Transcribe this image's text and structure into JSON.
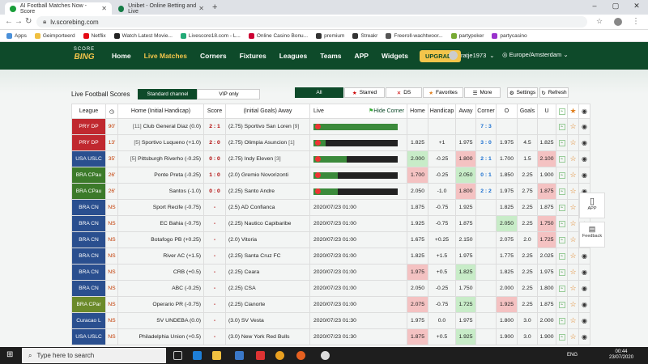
{
  "browser": {
    "tabs": [
      {
        "title": "AI Football Matches Now - Score",
        "favicon_color": "#1a9e3a"
      },
      {
        "title": "Unibet - Online Betting and Live",
        "favicon_color": "#147b45"
      }
    ],
    "url": "lv.scorebing.com",
    "bookmarks": [
      "Apps",
      "Geimporteerd",
      "Netflix",
      "Watch Latest Movie...",
      "Livescore18.com - L...",
      "Online Casino Bonu...",
      "premium",
      "Streakr",
      "Freeroll-wachtwoor...",
      "partypoker",
      "partycasino"
    ]
  },
  "site": {
    "logo_top": "SCORE",
    "logo_bottom": "BING",
    "nav": [
      "Home",
      "Live Matches",
      "Corners",
      "Fixtures",
      "Leagues",
      "Teams",
      "APP",
      "Widgets"
    ],
    "upgrade": "UPGRADE",
    "user": "ratje1973",
    "timezone": "Europe/Amsterdam",
    "brand_color": "#0e4a2a",
    "accent_color": "#f3c54b"
  },
  "panel": {
    "title": "Live Football Scores",
    "channels": [
      "Standard channel",
      "VIP only"
    ],
    "filters": [
      "All",
      "Starred",
      "DS",
      "Favorites",
      "More"
    ],
    "settings": "Settings",
    "refresh": "Refresh",
    "hide_corner": "Hide Corner"
  },
  "table": {
    "headers": {
      "league": "League",
      "home": "Home (Initial Handicap)",
      "score": "Score",
      "away": "(Initial Goals) Away",
      "live": "Live",
      "home_odds": "Home",
      "handicap": "Handicap",
      "away_odds": "Away",
      "corner": "Corner",
      "o": "O",
      "goals": "Goals",
      "u": "U"
    },
    "rows": [
      {
        "league": "PRY DP",
        "lc": "#c0282f",
        "min": "90'",
        "home": "Club General Diaz (0.0)",
        "hpre": "[11]",
        "score": "2 : 1",
        "away": "(2.75) Sportivo San Loren",
        "apost": "[9]",
        "live": "bar",
        "p": 100,
        "ho": "",
        "hc": "",
        "ao": "",
        "corner": "7 : 3",
        "o": "",
        "g": "",
        "u": "",
        "hcls": "",
        "acls": "",
        "ocls": "",
        "ucls": ""
      },
      {
        "league": "PRY DP",
        "lc": "#c0282f",
        "min": "13'",
        "home": "Sportivo Luqueno (+1.0)",
        "hpre": "[5]",
        "score": "2 : 0",
        "away": "(2.75) Olimpia Asuncion",
        "apost": "[1]",
        "live": "bar",
        "p": 14,
        "ho": "1.825",
        "hc": "+1",
        "ao": "1.975",
        "corner": "3 : 0",
        "o": "1.975",
        "g": "4.5",
        "u": "1.825",
        "hcls": "",
        "acls": "",
        "ocls": "",
        "ucls": ""
      },
      {
        "league": "USA USLC",
        "lc": "#2a4f8f",
        "min": "35'",
        "home": "Pittsburgh Riverho (-0.25)",
        "hpre": "[5]",
        "score": "0 : 0",
        "away": "(2.75) Indy Eleven",
        "apost": "[3]",
        "live": "bar",
        "p": 39,
        "ho": "2.000",
        "hc": "-0.25",
        "ao": "1.800",
        "corner": "2 : 1",
        "o": "1.700",
        "g": "1.5",
        "u": "2.100",
        "hcls": "grn",
        "acls": "red",
        "ocls": "",
        "ucls": "red"
      },
      {
        "league": "BRA CPau",
        "lc": "#3c7a2a",
        "min": "26'",
        "home": "Ponte Preta (-0.25)",
        "hpre": "",
        "score": "1 : 0",
        "away": "(2.0) Gremio Novorizonti",
        "apost": "",
        "live": "bar",
        "p": 29,
        "ho": "1.700",
        "hc": "-0.25",
        "ao": "2.050",
        "corner": "0 : 1",
        "o": "1.850",
        "g": "2.25",
        "u": "1.900",
        "hcls": "red",
        "acls": "grn",
        "ocls": "",
        "ucls": ""
      },
      {
        "league": "BRA CPau",
        "lc": "#3c7a2a",
        "min": "26'",
        "home": "Santos (-1.0)",
        "hpre": "",
        "score": "0 : 0",
        "away": "(2.25) Santo Andre",
        "apost": "",
        "live": "bar",
        "p": 29,
        "ho": "2.050",
        "hc": "-1.0",
        "ao": "1.800",
        "corner": "2 : 2",
        "o": "1.975",
        "g": "2.75",
        "u": "1.875",
        "hcls": "",
        "acls": "red",
        "ocls": "",
        "ucls": "red"
      },
      {
        "league": "BRA CN",
        "lc": "#2a4f8f",
        "min": "NS",
        "home": "Sport Recife (-0.75)",
        "hpre": "",
        "score": "-",
        "away": "(2.5) AD Confianca",
        "apost": "",
        "live": "2020/07/23 01:00",
        "p": 0,
        "ho": "1.875",
        "hc": "-0.75",
        "ao": "1.925",
        "corner": "",
        "o": "1.825",
        "g": "2.25",
        "u": "1.875",
        "hcls": "",
        "acls": "",
        "ocls": "",
        "ucls": ""
      },
      {
        "league": "BRA CN",
        "lc": "#2a4f8f",
        "min": "NS",
        "home": "EC Bahia (-0.75)",
        "hpre": "",
        "score": "-",
        "away": "(2.25) Nautico Capibaribe",
        "apost": "",
        "live": "2020/07/23 01:00",
        "p": 0,
        "ho": "1.925",
        "hc": "-0.75",
        "ao": "1.875",
        "corner": "",
        "o": "2.050",
        "g": "2.25",
        "u": "1.750",
        "hcls": "",
        "acls": "",
        "ocls": "grn",
        "ucls": "red"
      },
      {
        "league": "BRA CN",
        "lc": "#2a4f8f",
        "min": "NS",
        "home": "Botafogo PB (+0.25)",
        "hpre": "",
        "score": "-",
        "away": "(2.0) Vitoria",
        "apost": "",
        "live": "2020/07/23 01:00",
        "p": 0,
        "ho": "1.675",
        "hc": "+0.25",
        "ao": "2.150",
        "corner": "",
        "o": "2.075",
        "g": "2.0",
        "u": "1.725",
        "hcls": "",
        "acls": "",
        "ocls": "",
        "ucls": "red"
      },
      {
        "league": "BRA CN",
        "lc": "#2a4f8f",
        "min": "NS",
        "home": "River AC (+1.5)",
        "hpre": "",
        "score": "-",
        "away": "(2.25) Santa Cruz FC",
        "apost": "",
        "live": "2020/07/23 01:00",
        "p": 0,
        "ho": "1.825",
        "hc": "+1.5",
        "ao": "1.975",
        "corner": "",
        "o": "1.775",
        "g": "2.25",
        "u": "2.025",
        "hcls": "",
        "acls": "",
        "ocls": "",
        "ucls": ""
      },
      {
        "league": "BRA CN",
        "lc": "#2a4f8f",
        "min": "NS",
        "home": "CRB (+0.5)",
        "hpre": "",
        "score": "-",
        "away": "(2.25) Ceara",
        "apost": "",
        "live": "2020/07/23 01:00",
        "p": 0,
        "ho": "1.975",
        "hc": "+0.5",
        "ao": "1.825",
        "corner": "",
        "o": "1.825",
        "g": "2.25",
        "u": "1.975",
        "hcls": "red",
        "acls": "grn",
        "ocls": "",
        "ucls": ""
      },
      {
        "league": "BRA CN",
        "lc": "#2a4f8f",
        "min": "NS",
        "home": "ABC (-0.25)",
        "hpre": "",
        "score": "-",
        "away": "(2.25) CSA",
        "apost": "",
        "live": "2020/07/23 01:00",
        "p": 0,
        "ho": "2.050",
        "hc": "-0.25",
        "ao": "1.750",
        "corner": "",
        "o": "2.000",
        "g": "2.25",
        "u": "1.800",
        "hcls": "",
        "acls": "",
        "ocls": "",
        "ucls": ""
      },
      {
        "league": "BRA CPar",
        "lc": "#6b8a2a",
        "min": "NS",
        "home": "Operario PR (-0.75)",
        "hpre": "",
        "score": "-",
        "away": "(2.25) Cianorte",
        "apost": "",
        "live": "2020/07/23 01:00",
        "p": 0,
        "ho": "2.075",
        "hc": "-0.75",
        "ao": "1.725",
        "corner": "",
        "o": "1.925",
        "g": "2.25",
        "u": "1.875",
        "hcls": "red",
        "acls": "grn",
        "ocls": "red",
        "ucls": ""
      },
      {
        "league": "Curacao L",
        "lc": "#2a4f8f",
        "min": "NS",
        "home": "SV UNDEBA (0.0)",
        "hpre": "",
        "score": "-",
        "away": "(3.0) SV Vesta",
        "apost": "",
        "live": "2020/07/23 01:30",
        "p": 0,
        "ho": "1.975",
        "hc": "0.0",
        "ao": "1.975",
        "corner": "",
        "o": "1.800",
        "g": "3.0",
        "u": "2.000",
        "hcls": "",
        "acls": "",
        "ocls": "",
        "ucls": ""
      },
      {
        "league": "USA USLC",
        "lc": "#2a4f8f",
        "min": "NS",
        "home": "Philadelphia Union (+0.5)",
        "hpre": "",
        "score": "-",
        "away": "(3.0) New York Red Bulls",
        "apost": "",
        "live": "2020/07/23 01:30",
        "p": 0,
        "ho": "1.875",
        "hc": "+0.5",
        "ao": "1.925",
        "corner": "",
        "o": "1.900",
        "g": "3.0",
        "u": "1.900",
        "hcls": "red",
        "acls": "grn",
        "ocls": "",
        "ucls": ""
      }
    ]
  },
  "widgets": {
    "app": "APP",
    "feedback": "Feedback"
  },
  "taskbar": {
    "search": "Type here to search",
    "lang": "ENG",
    "time": "00:44",
    "date": "23/07/2020"
  }
}
